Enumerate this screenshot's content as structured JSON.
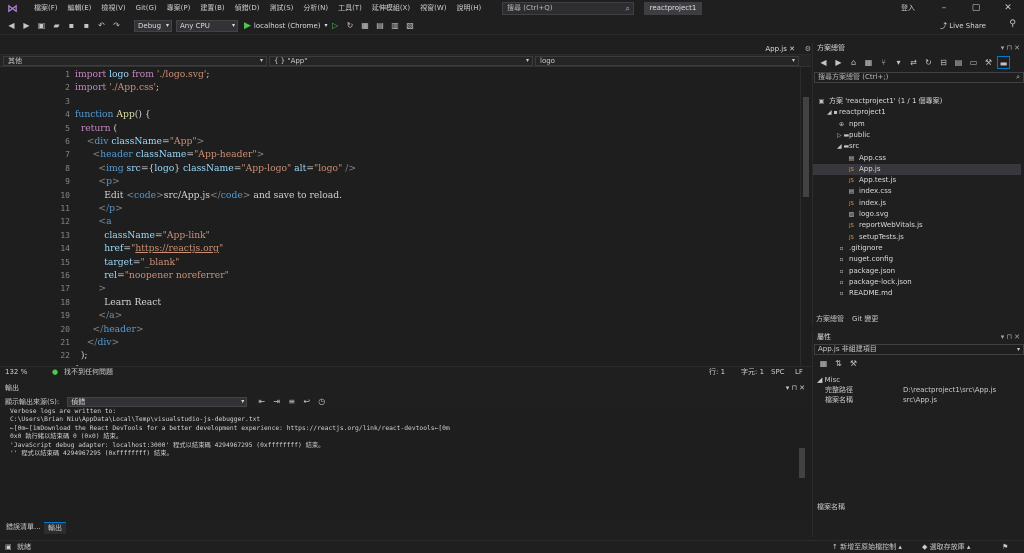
{
  "menu": [
    "檔案(F)",
    "編輯(E)",
    "檢視(V)",
    "Git(G)",
    "專案(P)",
    "建置(B)",
    "偵錯(D)",
    "測試(S)",
    "分析(N)",
    "工具(T)",
    "延伸模組(X)",
    "視窗(W)",
    "說明(H)"
  ],
  "search_placeholder": "搜尋 (Ctrl+Q)",
  "project_title": "reactproject1",
  "sign_in": "登入",
  "live_share": "Live Share",
  "toolbar": {
    "config": "Debug",
    "platform": "Any CPU",
    "run_target": "localhost (Chrome)"
  },
  "editor": {
    "tab_label": "App.js",
    "nav_left": "其他",
    "nav_mid": "{ } \"App\"",
    "nav_right": "logo",
    "lines": [
      {
        "n": "1",
        "html": "<span class=\"ctl\">import</span> <span class=\"var\">logo</span> <span class=\"ctl\">from</span> <span class=\"str\">'./logo.svg'</span>;"
      },
      {
        "n": "2",
        "html": "<span class=\"ctl\">import</span> <span class=\"str\">'./App.css'</span>;"
      },
      {
        "n": "3",
        "html": ""
      },
      {
        "n": "4",
        "html": "<span class=\"kw\">function</span> <span class=\"fn\">App</span>() {"
      },
      {
        "n": "5",
        "html": "  <span class=\"ctl\">return</span> ("
      },
      {
        "n": "6",
        "html": "    <span class=\"br\">&lt;</span><span class=\"tag\">div</span> <span class=\"attr\">className</span>=<span class=\"str\">\"App\"</span><span class=\"br\">&gt;</span>"
      },
      {
        "n": "7",
        "html": "      <span class=\"br\">&lt;</span><span class=\"tag\">header</span> <span class=\"attr\">className</span>=<span class=\"str\">\"App-header\"</span><span class=\"br\">&gt;</span>"
      },
      {
        "n": "8",
        "html": "        <span class=\"br\">&lt;</span><span class=\"tag\">img</span> <span class=\"attr\">src</span>={<span class=\"var\">logo</span>} <span class=\"attr\">className</span>=<span class=\"str\">\"App-logo\"</span> <span class=\"attr\">alt</span>=<span class=\"str\">\"logo\"</span> <span class=\"br\">/&gt;</span>"
      },
      {
        "n": "9",
        "html": "        <span class=\"br\">&lt;</span><span class=\"tag\">p</span><span class=\"br\">&gt;</span>"
      },
      {
        "n": "10",
        "html": "          Edit <span class=\"br\">&lt;</span><span class=\"tag\">code</span><span class=\"br\">&gt;</span>src/App.js<span class=\"br\">&lt;/</span><span class=\"tag\">code</span><span class=\"br\">&gt;</span> and save to reload."
      },
      {
        "n": "11",
        "html": "        <span class=\"br\">&lt;/</span><span class=\"tag\">p</span><span class=\"br\">&gt;</span>"
      },
      {
        "n": "12",
        "html": "        <span class=\"br\">&lt;</span><span class=\"tag\">a</span>"
      },
      {
        "n": "13",
        "html": "          <span class=\"attr\">className</span>=<span class=\"str\">\"App-link\"</span>"
      },
      {
        "n": "14",
        "html": "          <span class=\"attr\">href</span>=<span class=\"str\">\"<span class=\"link\">https://reactjs.org</span>\"</span>"
      },
      {
        "n": "15",
        "html": "          <span class=\"attr\">target</span>=<span class=\"str\">\"_blank\"</span>"
      },
      {
        "n": "16",
        "html": "          <span class=\"attr\">rel</span>=<span class=\"str\">\"noopener noreferrer\"</span>"
      },
      {
        "n": "17",
        "html": "        <span class=\"br\">&gt;</span>"
      },
      {
        "n": "18",
        "html": "          Learn React"
      },
      {
        "n": "19",
        "html": "        <span class=\"br\">&lt;/</span><span class=\"tag\">a</span><span class=\"br\">&gt;</span>"
      },
      {
        "n": "20",
        "html": "      <span class=\"br\">&lt;/</span><span class=\"tag\">header</span><span class=\"br\">&gt;</span>"
      },
      {
        "n": "21",
        "html": "    <span class=\"br\">&lt;/</span><span class=\"tag\">div</span><span class=\"br\">&gt;</span>"
      },
      {
        "n": "22",
        "html": "  );"
      },
      {
        "n": "23",
        "html": "}"
      }
    ],
    "zoom": "132 %",
    "issues": "找不到任何問題",
    "cursor_line": "行: 1",
    "cursor_col": "字元: 1",
    "whitespace": "SPC",
    "line_ending": "LF"
  },
  "output": {
    "title": "輸出",
    "source_label": "顯示輸出來源(S):",
    "source_value": "偵錯",
    "text": "Verbose logs are written to:\nC:\\Users\\Brian Niu\\AppData\\Local\\Temp\\visualstudio-js-debugger.txt\n←[0m←[1mDownload the React DevTools for a better development experience: https://reactjs.org/link/react-devtools←[0m\n0x0 執行緒以結束碼 0 (0x0) 結束。\n'JavaScript debug adapter: localhost:3000' 程式以結束碼 4294967295 (0xffffffff) 結束。\n'' 程式以結束碼 4294967295 (0xffffffff) 結束。",
    "tab_errors": "錯誤清單...",
    "tab_output": "輸出"
  },
  "solution_explorer": {
    "title": "方案總管",
    "search_placeholder": "搜尋方案總管 (Ctrl+;)",
    "items": [
      {
        "label": "方案 'reactproject1' (1 / 1 個專案)",
        "indent": 0,
        "icon": "▣"
      },
      {
        "label": "reactproject1",
        "indent": 1,
        "icon": "◢ ▪"
      },
      {
        "label": "npm",
        "indent": 2,
        "icon": "⊕"
      },
      {
        "label": "public",
        "indent": 2,
        "icon": "▷ ▬"
      },
      {
        "label": "src",
        "indent": 2,
        "icon": "◢ ▬"
      },
      {
        "label": "App.css",
        "indent": 3,
        "icon": "▤"
      },
      {
        "label": "App.js",
        "indent": 3,
        "icon": "JS",
        "selected": true
      },
      {
        "label": "App.test.js",
        "indent": 3,
        "icon": "JS"
      },
      {
        "label": "index.css",
        "indent": 3,
        "icon": "▤"
      },
      {
        "label": "index.js",
        "indent": 3,
        "icon": "JS"
      },
      {
        "label": "logo.svg",
        "indent": 3,
        "icon": "▨"
      },
      {
        "label": "reportWebVitals.js",
        "indent": 3,
        "icon": "JS"
      },
      {
        "label": "setupTests.js",
        "indent": 3,
        "icon": "JS"
      },
      {
        "label": ".gitignore",
        "indent": 2,
        "icon": "▫"
      },
      {
        "label": "nuget.config",
        "indent": 2,
        "icon": "▫"
      },
      {
        "label": "package.json",
        "indent": 2,
        "icon": "▫"
      },
      {
        "label": "package-lock.json",
        "indent": 2,
        "icon": "▫"
      },
      {
        "label": "README.md",
        "indent": 2,
        "icon": "▫"
      }
    ],
    "tab_solution": "方案總管",
    "tab_git": "Git 變更"
  },
  "properties": {
    "title": "屬性",
    "object": "App.js 非組建項目",
    "category": "Misc",
    "rows": [
      {
        "k": "完整路徑",
        "v": "D:\\reactproject1\\src\\App.js"
      },
      {
        "k": "檔案名稱",
        "v": "src\\App.js"
      }
    ],
    "desc_title": "檔案名稱"
  },
  "statusbar": {
    "ready": "就緒",
    "source_control": "新增至原始檔控制",
    "select_repo": "選取存放庫"
  },
  "colors": {
    "accent": "#007acc",
    "bg": "#1f1f1f",
    "selection": "#37373d"
  }
}
